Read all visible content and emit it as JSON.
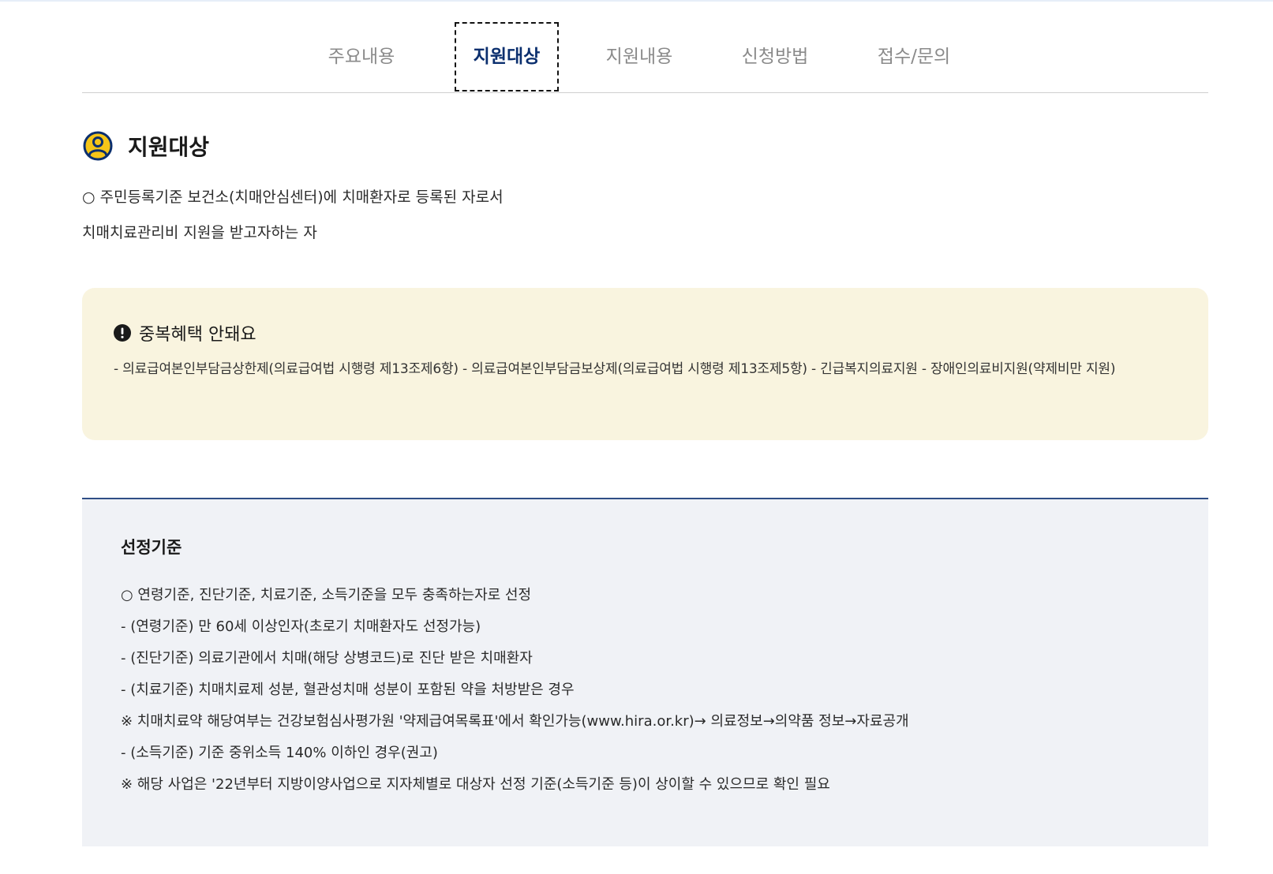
{
  "tabs": [
    {
      "label": "주요내용",
      "active": false
    },
    {
      "label": "지원대상",
      "active": true
    },
    {
      "label": "지원내용",
      "active": false
    },
    {
      "label": "신청방법",
      "active": false
    },
    {
      "label": "접수/문의",
      "active": false
    }
  ],
  "section": {
    "title": "지원대상",
    "icon": "person-circle-icon",
    "lines": [
      "○ 주민등록기준 보건소(치매안심센터)에 치매환자로 등록된 자로서",
      "치매치료관리비 지원을 받고자하는 자"
    ]
  },
  "notice": {
    "icon": "exclamation-circle-icon",
    "title": "중복혜택 안돼요",
    "body": "- 의료급여본인부담금상한제(의료급여법 시행령 제13조제6항) - 의료급여본인부담금보상제(의료급여법 시행령 제13조제5항) - 긴급복지의료지원 - 장애인의료비지원(약제비만 지원)",
    "background": "#f9f4df"
  },
  "criteria": {
    "title": "선정기준",
    "items": [
      "○ 연령기준, 진단기준, 치료기준, 소득기준을 모두 충족하는자로 선정",
      "- (연령기준) 만 60세 이상인자(초로기 치매환자도 선정가능)",
      "- (진단기준) 의료기관에서 치매(해당 상병코드)로 진단 받은 치매환자",
      "- (치료기준) 치매치료제 성분, 혈관성치매 성분이 포함된 약을 처방받은 경우",
      "※ 치매치료약 해당여부는 건강보험심사평가원 '약제급여목록표'에서 확인가능(www.hira.or.kr)→ 의료정보→의약품 정보→자료공개",
      "- (소득기준) 기준 중위소득 140% 이하인 경우(권고)",
      "※ 해당 사업은 '22년부터 지방이양사업으로 지자체별로 대상자 선정 기준(소득기준 등)이 상이할 수 있으므로 확인 필요"
    ],
    "background": "#f0f2f6",
    "accent": "#2f4e86"
  },
  "colors": {
    "active_tab": "#0b2f6e",
    "inactive_tab": "#8a8a8a",
    "icon_yellow": "#f5c518",
    "icon_navy": "#0b2f6e"
  }
}
